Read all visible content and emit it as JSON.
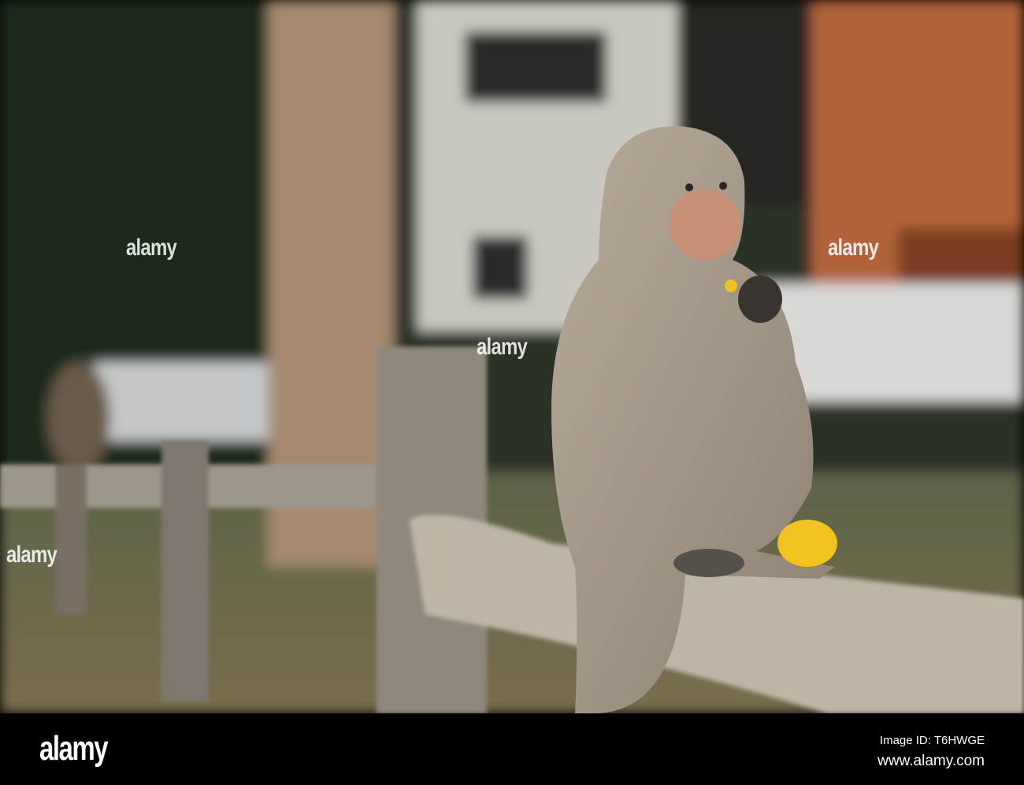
{
  "watermark": {
    "brand": "alamy",
    "image_id": "Image ID: T6HWGE",
    "site": "www.alamy.com"
  },
  "colors": {
    "background_foliage": "#2b3326",
    "trunk": "#a68a70",
    "fence_wood": "#b8b0a0",
    "monkey_fur": "#a79a8a",
    "corn": "#f2c21e",
    "footer": "#000000"
  }
}
